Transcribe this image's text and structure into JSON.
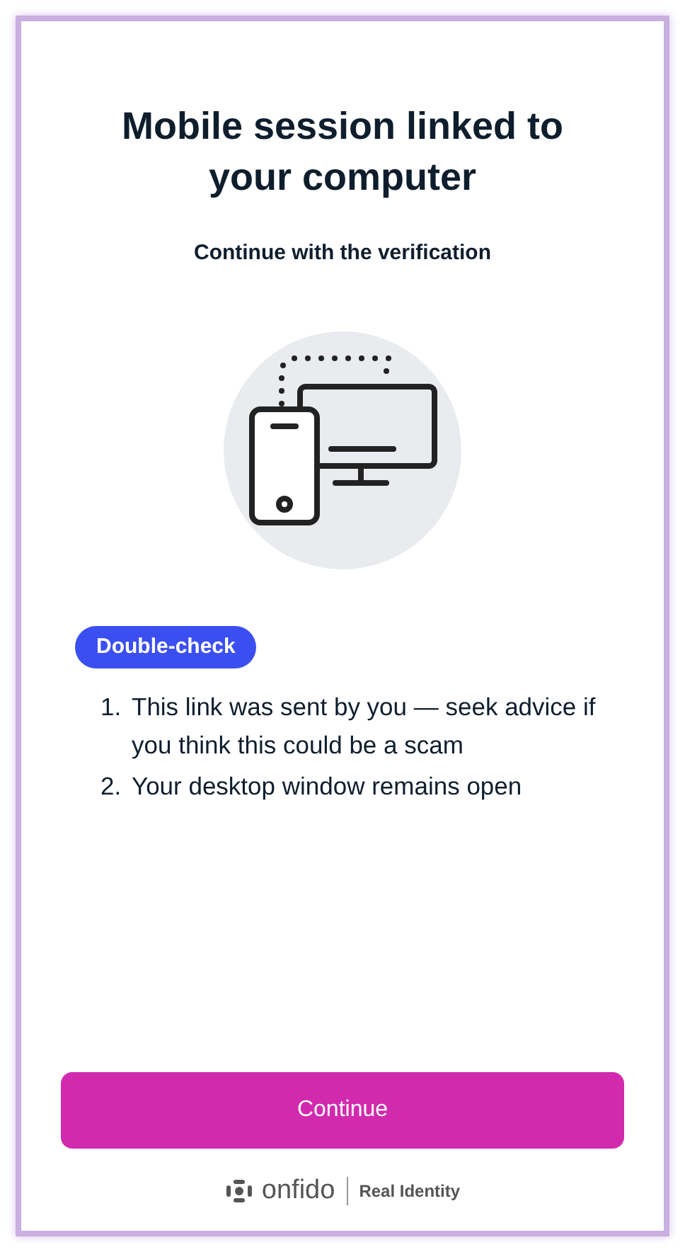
{
  "title": "Mobile session linked to your computer",
  "subtitle": "Continue with the verification",
  "badge": "Double-check",
  "steps": [
    {
      "number": "1.",
      "text": "This link was sent by you — seek advice if you think this could be a scam"
    },
    {
      "number": "2.",
      "text": "Your desktop window remains open"
    }
  ],
  "button": "Continue",
  "footer": {
    "brand": "onfido",
    "tagline": "Real Identity"
  }
}
